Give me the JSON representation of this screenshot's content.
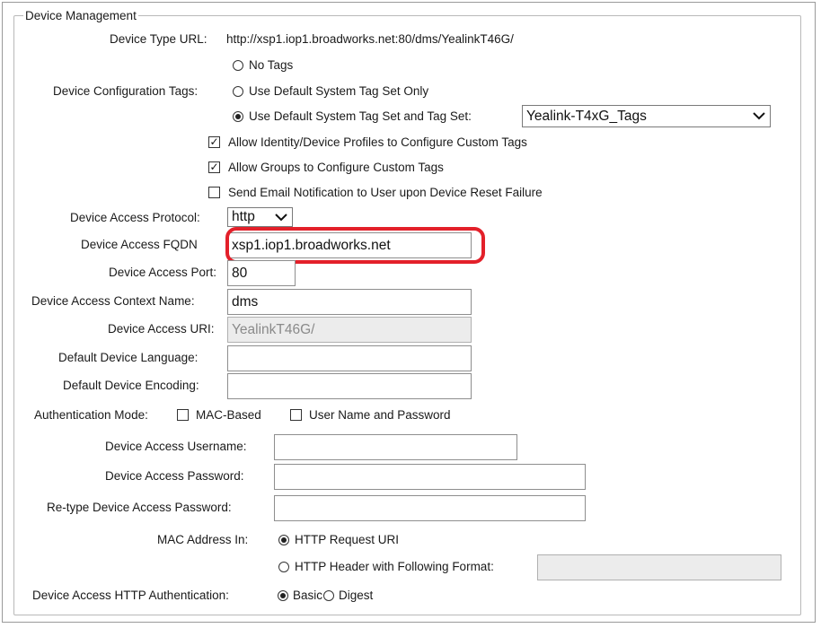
{
  "section": {
    "legend": "Device Management"
  },
  "device_type_url": {
    "label": "Device Type URL:",
    "value": "http://xsp1.iop1.broadworks.net:80/dms/YealinkT46G/"
  },
  "config_tags": {
    "label": "Device Configuration Tags:",
    "options": [
      "No Tags",
      "Use Default System Tag Set Only",
      "Use Default System Tag Set and Tag Set:"
    ],
    "selected_index": 2,
    "tag_set_value": "Yealink-T4xG_Tags"
  },
  "checkboxes": [
    {
      "label": "Allow Identity/Device Profiles to Configure Custom Tags",
      "checked": true
    },
    {
      "label": "Allow Groups to Configure Custom Tags",
      "checked": true
    },
    {
      "label": "Send Email Notification to User upon Device Reset Failure",
      "checked": false
    }
  ],
  "access_protocol": {
    "label": "Device Access Protocol:",
    "value": "http"
  },
  "fqdn": {
    "label": "Device Access FQDN",
    "value": "xsp1.iop1.broadworks.net"
  },
  "port": {
    "label": "Device Access Port:",
    "value": "80"
  },
  "context_name": {
    "label": "Device Access Context Name:",
    "value": "dms"
  },
  "access_uri": {
    "label": "Device Access URI:",
    "value": "YealinkT46G/"
  },
  "language": {
    "label": "Default Device Language:",
    "value": ""
  },
  "encoding": {
    "label": "Default Device Encoding:",
    "value": ""
  },
  "auth_mode": {
    "label": "Authentication Mode:",
    "mac_label": "MAC-Based",
    "user_label": "User Name and Password"
  },
  "username": {
    "label": "Device Access Username:",
    "value": ""
  },
  "password": {
    "label": "Device Access Password:",
    "value": ""
  },
  "retype_password": {
    "label": "Re-type Device Access Password:",
    "value": ""
  },
  "mac_in": {
    "label": "MAC Address In:",
    "option_uri": "HTTP Request URI",
    "option_header": "HTTP Header with Following Format:",
    "header_format_value": ""
  },
  "http_auth": {
    "label": "Device Access HTTP Authentication:",
    "basic": "Basic",
    "digest": "Digest"
  }
}
